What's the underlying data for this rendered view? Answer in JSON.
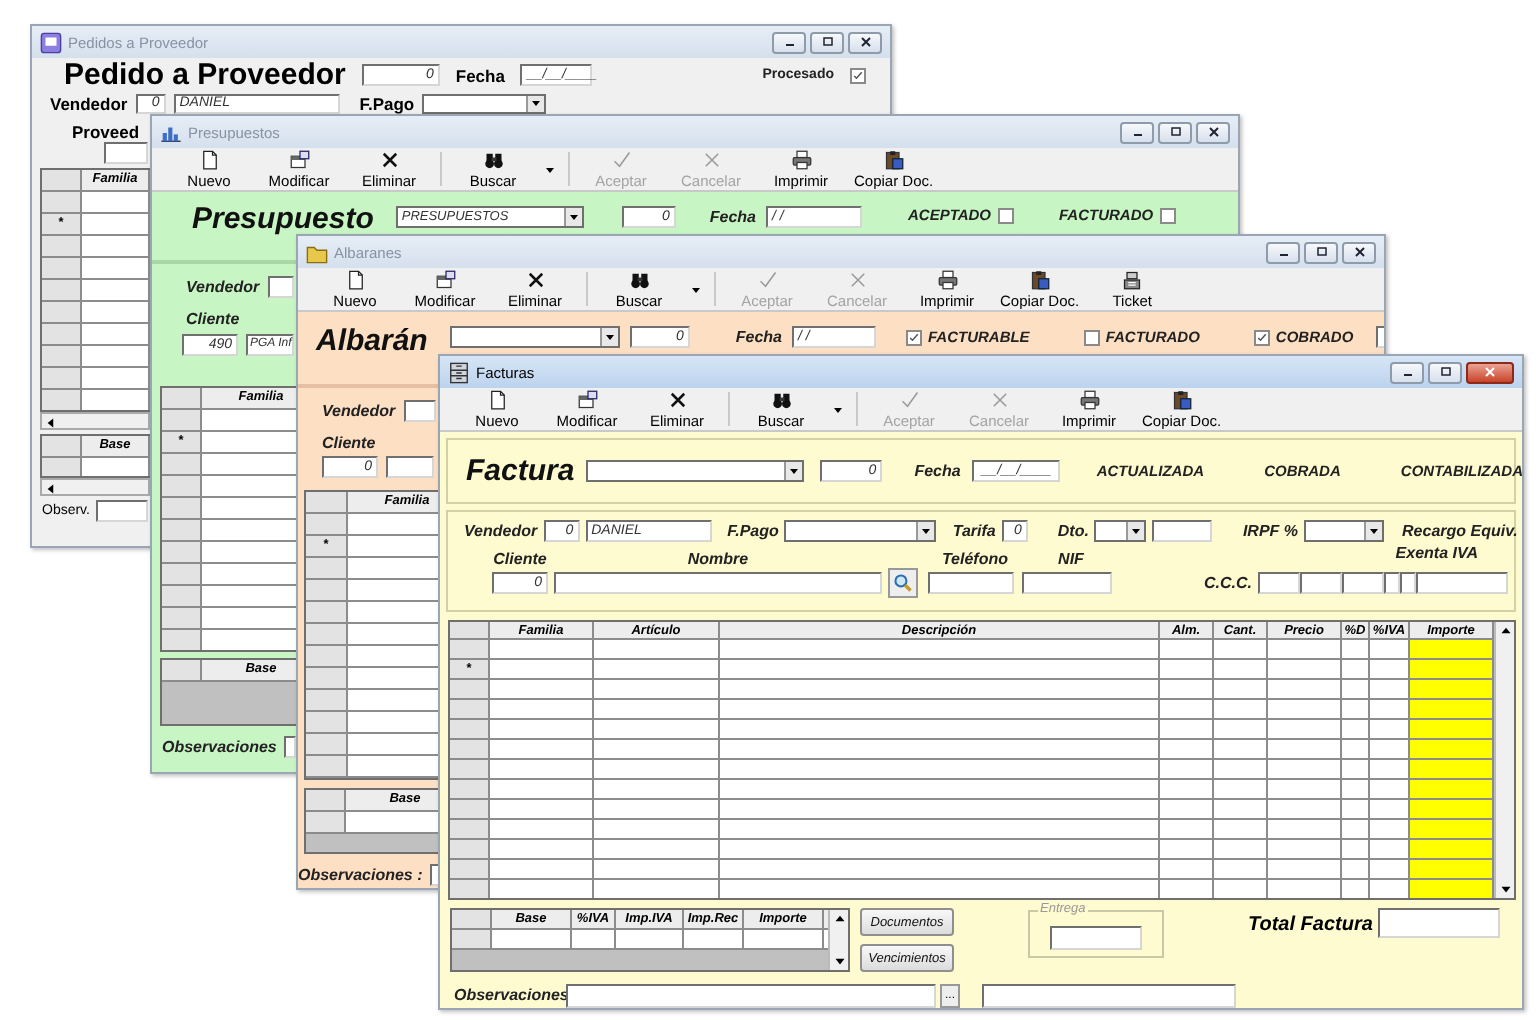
{
  "windows": [
    {
      "kind": "pedido",
      "title": "Pedidos a Proveedor",
      "active": false,
      "heading": "Pedido a Proveedor",
      "number": "0",
      "date_label": "Fecha",
      "date": "__/__/____",
      "flags": [
        {
          "label": "Procesado",
          "checked": true
        }
      ],
      "vendedor_label": "Vendedor",
      "vendedor_code": "0",
      "vendedor_name": "DANIEL",
      "fpago_label": "F.Pago",
      "proveedor_label": "Proveed",
      "grid": {
        "columns": [
          "Familia"
        ],
        "marker": "*"
      },
      "totals": {
        "columns": [
          "Base"
        ]
      },
      "notes_label": "Observ."
    },
    {
      "kind": "presupuesto",
      "title": "Presupuestos",
      "active": false,
      "toolbar": [
        {
          "label": "Nuevo",
          "disabled": false
        },
        {
          "label": "Modificar",
          "disabled": false
        },
        {
          "label": "Eliminar",
          "disabled": false
        },
        {
          "label": "Buscar",
          "disabled": false
        },
        {
          "label": "Aceptar",
          "disabled": true
        },
        {
          "label": "Cancelar",
          "disabled": true
        },
        {
          "label": "Imprimir",
          "disabled": false
        },
        {
          "label": "Copiar Doc.",
          "disabled": false
        }
      ],
      "heading": "Presupuesto",
      "series": "PRESUPUESTOS",
      "number": "0",
      "date_label": "Fecha",
      "date": "/  /",
      "flags": [
        {
          "label": "ACEPTADO",
          "checked": false
        },
        {
          "label": "FACTURADO",
          "checked": false
        }
      ],
      "vendedor_label": "Vendedor",
      "cliente_label": "Cliente",
      "cliente_code": "490",
      "cliente_name": "PGA Inf",
      "grid": {
        "columns": [
          "Familia"
        ],
        "marker": "*"
      },
      "totals": {
        "columns": [
          "Base"
        ]
      },
      "notes_label": "Observaciones"
    },
    {
      "kind": "albaran",
      "title": "Albaranes",
      "active": false,
      "toolbar": [
        {
          "label": "Nuevo",
          "disabled": false
        },
        {
          "label": "Modificar",
          "disabled": false
        },
        {
          "label": "Eliminar",
          "disabled": false
        },
        {
          "label": "Buscar",
          "disabled": false
        },
        {
          "label": "Aceptar",
          "disabled": true
        },
        {
          "label": "Cancelar",
          "disabled": true
        },
        {
          "label": "Imprimir",
          "disabled": false
        },
        {
          "label": "Copiar Doc.",
          "disabled": false
        },
        {
          "label": "Ticket",
          "disabled": false
        }
      ],
      "heading": "Albarán",
      "number": "0",
      "date_label": "Fecha",
      "date": "/  /",
      "flags": [
        {
          "label": "FACTURABLE",
          "checked": true
        },
        {
          "label": "FACTURADO",
          "checked": false
        },
        {
          "label": "COBRADO",
          "checked": true
        }
      ],
      "vendedor_label": "Vendedor",
      "cliente_label": "Cliente",
      "cliente_code": "0",
      "grid": {
        "columns": [
          "Familia"
        ],
        "marker": "*"
      },
      "totals": {
        "columns": [
          "Base"
        ]
      },
      "notes_label": "Observaciones :"
    },
    {
      "kind": "factura",
      "title": "Facturas",
      "active": true,
      "toolbar": [
        {
          "label": "Nuevo",
          "disabled": false
        },
        {
          "label": "Modificar",
          "disabled": false
        },
        {
          "label": "Eliminar",
          "disabled": false
        },
        {
          "label": "Buscar",
          "disabled": false
        },
        {
          "label": "Aceptar",
          "disabled": true
        },
        {
          "label": "Cancelar",
          "disabled": true
        },
        {
          "label": "Imprimir",
          "disabled": false
        },
        {
          "label": "Copiar Doc.",
          "disabled": false
        }
      ],
      "heading": "Factura",
      "number": "0",
      "date_label": "Fecha",
      "date": "__/__/____",
      "status_labels": [
        "ACTUALIZADA",
        "COBRADA",
        "CONTABILIZADA"
      ],
      "vendedor_label": "Vendedor",
      "vendedor_code": "0",
      "vendedor_name": "DANIEL",
      "fpago_label": "F.Pago",
      "tarifa_label": "Tarifa",
      "tarifa": "0",
      "dto_label": "Dto.",
      "irpf_label": "IRPF %",
      "recargo_label": "Recargo Equiv.",
      "exenta_label": "Exenta IVA",
      "cliente_label": "Cliente",
      "nombre_label": "Nombre",
      "telefono_label": "Teléfono",
      "nif_label": "NIF",
      "cliente_code": "0",
      "ccc_label": "C.C.C.",
      "grid": {
        "columns": [
          "Familia",
          "Artículo",
          "Descripción",
          "Alm.",
          "Cant.",
          "Precio",
          "%D",
          "%IVA",
          "Importe"
        ],
        "marker": "*"
      },
      "totals": {
        "columns": [
          "Base",
          "%IVA",
          "Imp.IVA",
          "Imp.Rec",
          "Importe"
        ]
      },
      "buttons": [
        "Documentos",
        "Vencimientos"
      ],
      "entrega_label": "Entrega",
      "total_label": "Total Factura",
      "notes_label": "Observaciones",
      "more_button": "..."
    }
  ]
}
